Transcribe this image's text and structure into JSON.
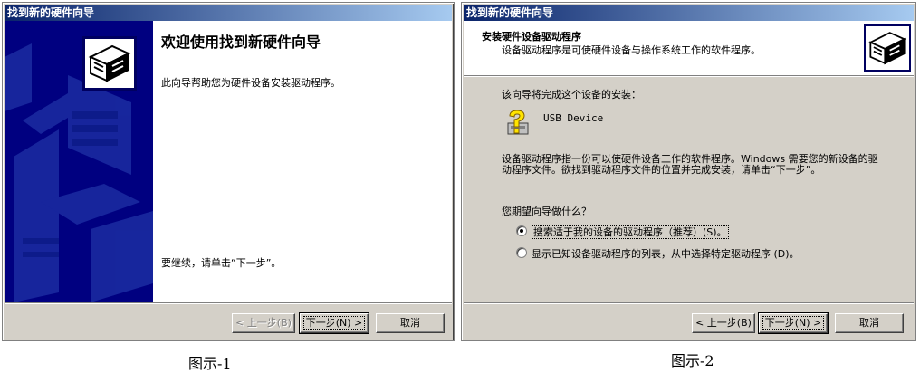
{
  "window1": {
    "title": "找到新的硬件向导",
    "heading": "欢迎使用找到新硬件向导",
    "body": "此向导帮助您为硬件设备安装驱动程序。",
    "continue_text": "要继续，请单击“下一步”。",
    "back_label": "< 上一步(B)",
    "next_label": "下一步(N) >",
    "cancel_label": "取消"
  },
  "window2": {
    "title": "找到新的硬件向导",
    "header_title": "安装硬件设备驱动程序",
    "header_subtitle": "设备驱动程序是可使硬件设备与操作系统工作的软件程序。",
    "intro": "该向导将完成这个设备的安装：",
    "device_name": "USB Device",
    "description": "设备驱动程序指一份可以使硬件设备工作的软件程序。Windows 需要您的新设备的驱动程序文件。欲找到驱动程序文件的位置并完成安装，请单击“下一步”。",
    "question": "您期望向导做什么？",
    "option_search": "搜索适于我的设备的驱动程序（推荐）(S)。",
    "option_list": "显示已知设备驱动程序的列表，从中选择特定驱动程序 (D)。",
    "selected_option": "search",
    "back_label": "< 上一步(B)",
    "next_label": "下一步(N) >",
    "cancel_label": "取消"
  },
  "captions": {
    "figure1": "图示-1",
    "figure2": "图示-2"
  },
  "colors": {
    "title_start": "#0a246a",
    "title_end": "#a6caf0",
    "side_panel": "#000080",
    "dialog_face": "#d4d0c8"
  },
  "icons": {
    "hardware": "hardware-wizard-icon",
    "device": "question-device-icon",
    "radio_selected": "radio-selected",
    "radio_unselected": "radio-unselected"
  }
}
